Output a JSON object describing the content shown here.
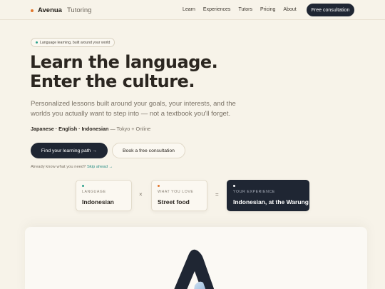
{
  "nav": {
    "brand_name": "Avenua",
    "brand_sub": "Tutoring",
    "links": [
      "Learn",
      "Experiences",
      "Tutors",
      "Pricing",
      "About"
    ],
    "cta": "Free consultation"
  },
  "hero": {
    "pill": "Language learning, built around your world",
    "headline_line1": "Learn the language.",
    "headline_line2": "Enter the culture.",
    "subtext": "Personalized lessons built around your goals, your interests, and the worlds you actually want to step into — not a textbook you'll forget.",
    "languages": "Japanese · English · Indonesian",
    "location": "— Tokyo + Online",
    "primary_button": "Find your learning path →",
    "secondary_button": "Book a free consultation",
    "already_text": "Already know what you need?",
    "skip_link": "Skip ahead →"
  },
  "formula": {
    "cards": [
      {
        "caption": "LANGUAGE",
        "value": "Indonesian",
        "dot_color": "#2fa28e"
      },
      {
        "caption": "WHAT YOU LOVE",
        "value": "Street food",
        "dot_color": "#e2762c"
      },
      {
        "caption": "YOUR EXPERIENCE",
        "value": "Indonesian, at the Warung",
        "dot_color": "#ffffff"
      }
    ],
    "op_times": "×",
    "op_equals": "="
  },
  "colors": {
    "background": "#f7f3e9",
    "dark": "#1f2633",
    "accent_orange": "#e2762c",
    "accent_teal": "#2fa28e"
  }
}
